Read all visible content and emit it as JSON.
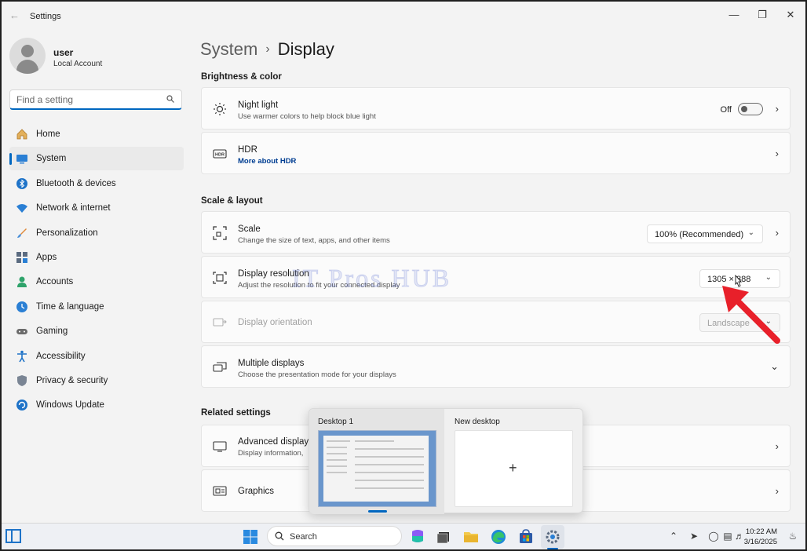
{
  "window": {
    "title": "Settings"
  },
  "profile": {
    "name": "user",
    "account_type": "Local Account"
  },
  "search": {
    "placeholder": "Find a setting"
  },
  "nav": {
    "items": [
      {
        "label": "Home"
      },
      {
        "label": "System"
      },
      {
        "label": "Bluetooth & devices"
      },
      {
        "label": "Network & internet"
      },
      {
        "label": "Personalization"
      },
      {
        "label": "Apps"
      },
      {
        "label": "Accounts"
      },
      {
        "label": "Time & language"
      },
      {
        "label": "Gaming"
      },
      {
        "label": "Accessibility"
      },
      {
        "label": "Privacy & security"
      },
      {
        "label": "Windows Update"
      }
    ],
    "active": "System"
  },
  "breadcrumb": {
    "parent": "System",
    "current": "Display"
  },
  "sections": {
    "brightness": "Brightness & color",
    "scale_layout": "Scale & layout",
    "related": "Related settings"
  },
  "cards": {
    "night_light": {
      "title": "Night light",
      "subtitle": "Use warmer colors to help block blue light",
      "state": "Off"
    },
    "hdr": {
      "title": "HDR",
      "link": "More about HDR"
    },
    "scale": {
      "title": "Scale",
      "subtitle": "Change the size of text, apps, and other items",
      "value": "100% (Recommended)"
    },
    "resolution": {
      "title": "Display resolution",
      "subtitle": "Adjust the resolution to fit your connected display",
      "value": "1305 × 888"
    },
    "orientation": {
      "title": "Display orientation",
      "value": "Landscape"
    },
    "multiple": {
      "title": "Multiple displays",
      "subtitle": "Choose the presentation mode for your displays"
    },
    "advanced": {
      "title": "Advanced display",
      "subtitle": "Display information,"
    },
    "graphics": {
      "title": "Graphics"
    }
  },
  "watermark": "IT Pros HUB",
  "task_view": {
    "desktop1": "Desktop 1",
    "new_desktop": "New desktop",
    "plus": "+"
  },
  "taskbar": {
    "search_label": "Search",
    "time": "10:22 AM",
    "date": "3/16/2025"
  },
  "colors": {
    "accent": "#0067c0",
    "arrow": "#e8202a"
  }
}
